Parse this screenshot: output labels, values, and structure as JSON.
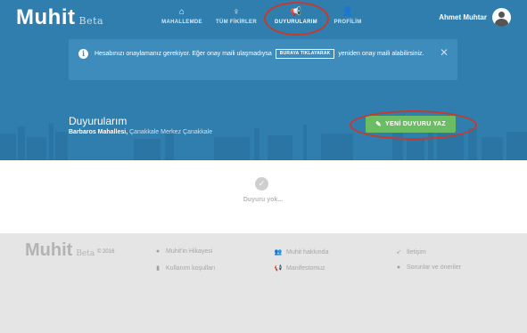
{
  "brand": {
    "name": "Muhit",
    "beta": "Beta"
  },
  "nav": [
    {
      "label": "MAHALLEMDE",
      "icon": "home-icon",
      "glyph": "⌂"
    },
    {
      "label": "TÜM FİKİRLER",
      "icon": "lightbulb-icon",
      "glyph": "♀"
    },
    {
      "label": "DUYURULARIM",
      "icon": "megaphone-icon",
      "glyph": "📢"
    },
    {
      "label": "PROFİLİM",
      "icon": "user-icon",
      "glyph": "👤"
    }
  ],
  "user": {
    "name": "Ahmet Muhtar"
  },
  "alert": {
    "text_before": "Hesabınızı onaylamanız gerekiyor. Eğer onay maili ulaşmadıysa",
    "button": "BURAYA TIKLAYARAK",
    "text_after": "yeniden onay maili alabilirsiniz.",
    "close": "✕"
  },
  "page": {
    "title": "Duyurularım",
    "breadcrumb_bold": "Barbaros Mahallesi,",
    "breadcrumb_rest": "Çanakkale Merkez Çanakkale",
    "new_button": "YENİ DUYURU YAZ"
  },
  "empty": {
    "text": "Duyuru yok..."
  },
  "footer": {
    "year": "© 2016",
    "links": [
      {
        "label": "Muhit'in Hikayesi",
        "icon": "circle-icon",
        "glyph": "●"
      },
      {
        "label": "Kullanım koşulları",
        "icon": "document-icon",
        "glyph": "▮"
      },
      {
        "label": "Muhit hakkında",
        "icon": "users-icon",
        "glyph": "👥"
      },
      {
        "label": "Manifestomuz",
        "icon": "megaphone-icon",
        "glyph": "📢"
      },
      {
        "label": "İletişim",
        "icon": "send-icon",
        "glyph": "➶"
      },
      {
        "label": "Sorunlar ve öneriler",
        "icon": "bug-icon",
        "glyph": "●"
      }
    ]
  },
  "colors": {
    "header": "#2f7eae",
    "accent_green": "#6abd63",
    "highlight_red": "#c8392b"
  }
}
